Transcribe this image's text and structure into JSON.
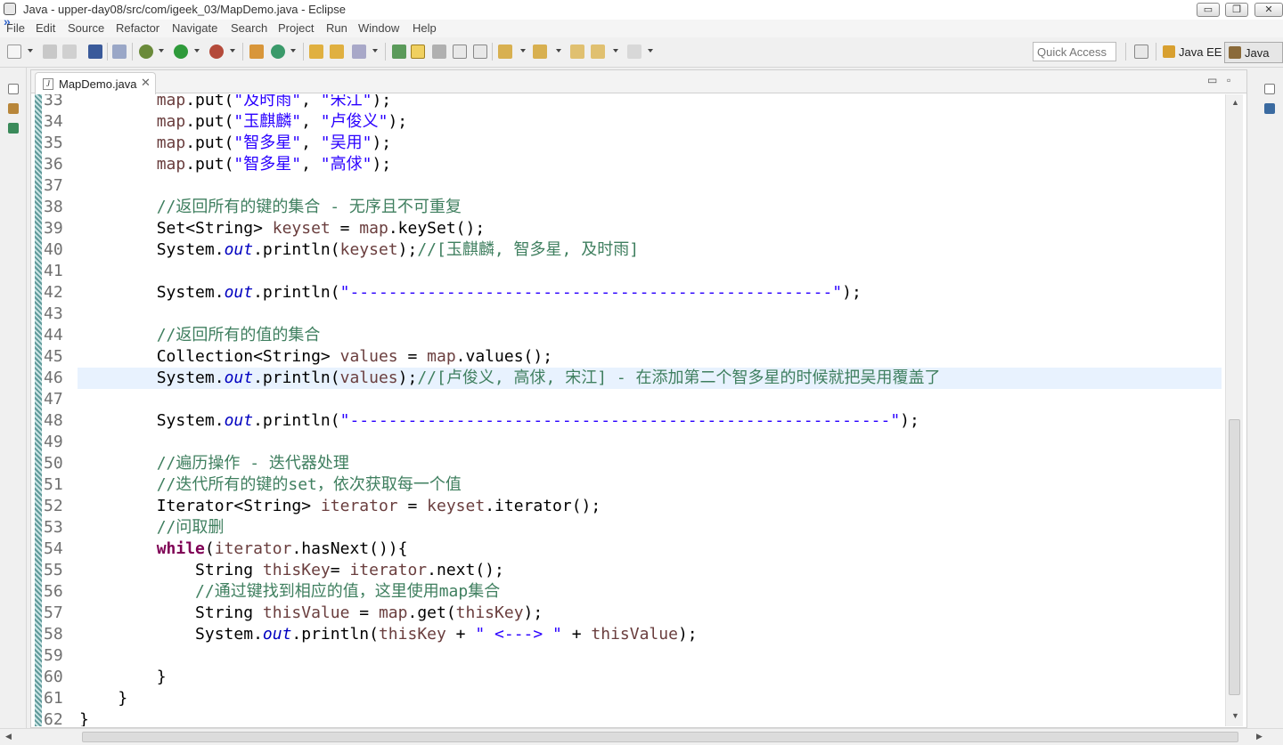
{
  "window": {
    "title": "Java - upper-day08/src/com/igeek_03/MapDemo.java - Eclipse",
    "minimize": "▭",
    "maximize": "❐",
    "close": "✕"
  },
  "menu": [
    "File",
    "Edit",
    "Source",
    "Refactor",
    "Navigate",
    "Search",
    "Project",
    "Run",
    "Window",
    "Help"
  ],
  "toolbar": {
    "quick_access_placeholder": "Quick Access",
    "perspective_java_ee": "Java EE",
    "perspective_java": "Java"
  },
  "editor": {
    "tab_label": "MapDemo.java",
    "tab_close": "✕",
    "tab_file_glyph": "J",
    "minimize": "▭",
    "maximize": "▫",
    "current_line": 46,
    "lines": [
      {
        "num": "33",
        "tokens": [
          {
            "t": "        "
          },
          {
            "t": "map",
            "c": "var"
          },
          {
            "t": ".put("
          },
          {
            "t": "\"及时雨\"",
            "c": "str"
          },
          {
            "t": ", "
          },
          {
            "t": "\"宋江\"",
            "c": "str"
          },
          {
            "t": ");"
          }
        ]
      },
      {
        "num": "34",
        "tokens": [
          {
            "t": "        "
          },
          {
            "t": "map",
            "c": "var"
          },
          {
            "t": ".put("
          },
          {
            "t": "\"玉麒麟\"",
            "c": "str"
          },
          {
            "t": ", "
          },
          {
            "t": "\"卢俊义\"",
            "c": "str"
          },
          {
            "t": ");"
          }
        ]
      },
      {
        "num": "35",
        "tokens": [
          {
            "t": "        "
          },
          {
            "t": "map",
            "c": "var"
          },
          {
            "t": ".put("
          },
          {
            "t": "\"智多星\"",
            "c": "str"
          },
          {
            "t": ", "
          },
          {
            "t": "\"吴用\"",
            "c": "str"
          },
          {
            "t": ");"
          }
        ]
      },
      {
        "num": "36",
        "tokens": [
          {
            "t": "        "
          },
          {
            "t": "map",
            "c": "var"
          },
          {
            "t": ".put("
          },
          {
            "t": "\"智多星\"",
            "c": "str"
          },
          {
            "t": ", "
          },
          {
            "t": "\"高俅\"",
            "c": "str"
          },
          {
            "t": ");"
          }
        ]
      },
      {
        "num": "37",
        "tokens": []
      },
      {
        "num": "38",
        "tokens": [
          {
            "t": "        "
          },
          {
            "t": "//返回所有的键的集合 - 无序且不可重复",
            "c": "com"
          }
        ]
      },
      {
        "num": "39",
        "tokens": [
          {
            "t": "        Set<String> "
          },
          {
            "t": "keyset",
            "c": "var"
          },
          {
            "t": " = "
          },
          {
            "t": "map",
            "c": "var"
          },
          {
            "t": ".keySet();"
          }
        ]
      },
      {
        "num": "40",
        "tokens": [
          {
            "t": "        System."
          },
          {
            "t": "out",
            "c": "field"
          },
          {
            "t": ".println("
          },
          {
            "t": "keyset",
            "c": "var"
          },
          {
            "t": ");"
          },
          {
            "t": "//[玉麒麟, 智多星, 及时雨]",
            "c": "com"
          }
        ]
      },
      {
        "num": "41",
        "tokens": []
      },
      {
        "num": "42",
        "tokens": [
          {
            "t": "        System."
          },
          {
            "t": "out",
            "c": "field"
          },
          {
            "t": ".println("
          },
          {
            "t": "\"--------------------------------------------------\"",
            "c": "str"
          },
          {
            "t": ");"
          }
        ]
      },
      {
        "num": "43",
        "tokens": []
      },
      {
        "num": "44",
        "tokens": [
          {
            "t": "        "
          },
          {
            "t": "//返回所有的值的集合",
            "c": "com"
          }
        ]
      },
      {
        "num": "45",
        "tokens": [
          {
            "t": "        Collection<String> "
          },
          {
            "t": "values",
            "c": "var"
          },
          {
            "t": " = "
          },
          {
            "t": "map",
            "c": "var"
          },
          {
            "t": ".values();"
          }
        ]
      },
      {
        "num": "46",
        "tokens": [
          {
            "t": "        System."
          },
          {
            "t": "out",
            "c": "field"
          },
          {
            "t": ".println("
          },
          {
            "t": "values",
            "c": "var"
          },
          {
            "t": ");"
          },
          {
            "t": "//[卢俊义, 高俅, 宋江] - 在添加第二个智多星的时候就把吴用覆盖了",
            "c": "com"
          }
        ]
      },
      {
        "num": "47",
        "tokens": []
      },
      {
        "num": "48",
        "tokens": [
          {
            "t": "        System."
          },
          {
            "t": "out",
            "c": "field"
          },
          {
            "t": ".println("
          },
          {
            "t": "\"--------------------------------------------------------\"",
            "c": "str"
          },
          {
            "t": ");"
          }
        ]
      },
      {
        "num": "49",
        "tokens": []
      },
      {
        "num": "50",
        "tokens": [
          {
            "t": "        "
          },
          {
            "t": "//遍历操作 - 迭代器处理",
            "c": "com"
          }
        ]
      },
      {
        "num": "51",
        "tokens": [
          {
            "t": "        "
          },
          {
            "t": "//迭代所有的键的set，依次获取每一个值",
            "c": "com"
          }
        ]
      },
      {
        "num": "52",
        "tokens": [
          {
            "t": "        Iterator<String> "
          },
          {
            "t": "iterator",
            "c": "var"
          },
          {
            "t": " = "
          },
          {
            "t": "keyset",
            "c": "var"
          },
          {
            "t": ".iterator();"
          }
        ]
      },
      {
        "num": "53",
        "tokens": [
          {
            "t": "        "
          },
          {
            "t": "//问取删",
            "c": "com"
          }
        ]
      },
      {
        "num": "54",
        "tokens": [
          {
            "t": "        "
          },
          {
            "t": "while",
            "c": "kw"
          },
          {
            "t": "("
          },
          {
            "t": "iterator",
            "c": "var"
          },
          {
            "t": ".hasNext()){"
          }
        ]
      },
      {
        "num": "55",
        "tokens": [
          {
            "t": "            String "
          },
          {
            "t": "thisKey",
            "c": "var"
          },
          {
            "t": "= "
          },
          {
            "t": "iterator",
            "c": "var"
          },
          {
            "t": ".next();"
          }
        ]
      },
      {
        "num": "56",
        "tokens": [
          {
            "t": "            "
          },
          {
            "t": "//通过键找到相应的值，这里使用map集合",
            "c": "com"
          }
        ]
      },
      {
        "num": "57",
        "tokens": [
          {
            "t": "            String "
          },
          {
            "t": "thisValue",
            "c": "var"
          },
          {
            "t": " = "
          },
          {
            "t": "map",
            "c": "var"
          },
          {
            "t": ".get("
          },
          {
            "t": "thisKey",
            "c": "var"
          },
          {
            "t": ");"
          }
        ]
      },
      {
        "num": "58",
        "tokens": [
          {
            "t": "            System."
          },
          {
            "t": "out",
            "c": "field"
          },
          {
            "t": ".println("
          },
          {
            "t": "thisKey",
            "c": "var"
          },
          {
            "t": " + "
          },
          {
            "t": "\" <---> \"",
            "c": "str"
          },
          {
            "t": " + "
          },
          {
            "t": "thisValue",
            "c": "var"
          },
          {
            "t": ");"
          }
        ]
      },
      {
        "num": "59",
        "tokens": []
      },
      {
        "num": "60",
        "tokens": [
          {
            "t": "        }"
          }
        ]
      },
      {
        "num": "61",
        "tokens": [
          {
            "t": "    }"
          }
        ]
      },
      {
        "num": "62",
        "tokens": [
          {
            "t": "}"
          }
        ]
      }
    ]
  },
  "scroll": {
    "up": "▲",
    "down": "▼",
    "left": "◀",
    "right": "▶"
  },
  "colors": {
    "keyword": "#7f0055",
    "string": "#2a00ff",
    "comment": "#3f7f5f",
    "field": "#0000c0",
    "variable": "#6a3e3e",
    "current_line": "#e8f2fe"
  }
}
